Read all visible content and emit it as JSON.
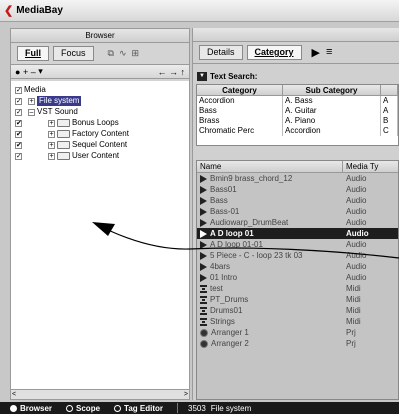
{
  "window": {
    "title": "MediaBay"
  },
  "browser": {
    "header": "Browser",
    "tabs": [
      "Full",
      "Focus"
    ],
    "tree": [
      {
        "label": "Media",
        "depth": 0
      },
      {
        "label": "File system",
        "depth": 1,
        "selected": true
      },
      {
        "label": "VST Sound",
        "depth": 1
      },
      {
        "label": "Bonus Loops",
        "depth": 2
      },
      {
        "label": "Factory Content",
        "depth": 2
      },
      {
        "label": "Sequel Content",
        "depth": 2
      },
      {
        "label": "User Content",
        "depth": 2
      }
    ]
  },
  "results": {
    "tabs": [
      "Details",
      "Category"
    ],
    "text_search_label": "Text Search:",
    "category_table": {
      "headers": [
        "Category",
        "Sub Category"
      ],
      "rows": [
        [
          "Accordion",
          "A. Bass",
          "A"
        ],
        [
          "Bass",
          "A. Guitar",
          "A"
        ],
        [
          "Brass",
          "A. Piano",
          "B"
        ],
        [
          "Chromatic Perc",
          "Accordion",
          "C"
        ]
      ]
    },
    "columns": {
      "name": "Name",
      "type": "Media Ty"
    },
    "rows": [
      {
        "name": "Bmin9 brass_chord_12",
        "type": "Audio",
        "icon": "audio"
      },
      {
        "name": "Bass01",
        "type": "Audio",
        "icon": "audio"
      },
      {
        "name": "Bass",
        "type": "Audio",
        "icon": "audio"
      },
      {
        "name": "Bass-01",
        "type": "Audio",
        "icon": "audio"
      },
      {
        "name": "Audiowarp_DrumBeat",
        "type": "Audio",
        "icon": "audio"
      },
      {
        "name": "A D loop 01",
        "type": "Audio",
        "icon": "audio",
        "highlight": true
      },
      {
        "name": "A D loop 01-01",
        "type": "Audio",
        "icon": "audio"
      },
      {
        "name": "5 Piece - C - loop 23 tk 03",
        "type": "Audio",
        "icon": "audio"
      },
      {
        "name": "4bars",
        "type": "Audio",
        "icon": "audio"
      },
      {
        "name": "01 Intro",
        "type": "Audio",
        "icon": "audio"
      },
      {
        "name": "test",
        "type": "Midi",
        "icon": "midi"
      },
      {
        "name": "PT_Drums",
        "type": "Midi",
        "icon": "midi"
      },
      {
        "name": "Drums01",
        "type": "Midi",
        "icon": "midi"
      },
      {
        "name": "Strings",
        "type": "Midi",
        "icon": "midi"
      },
      {
        "name": "Arranger 1",
        "type": "Prj",
        "icon": "prj"
      },
      {
        "name": "Arranger 2",
        "type": "Prj",
        "icon": "prj"
      }
    ]
  },
  "status": {
    "browser": "Browser",
    "scope": "Scope",
    "tag_editor": "Tag Editor",
    "count": "3503",
    "location": "File system"
  }
}
